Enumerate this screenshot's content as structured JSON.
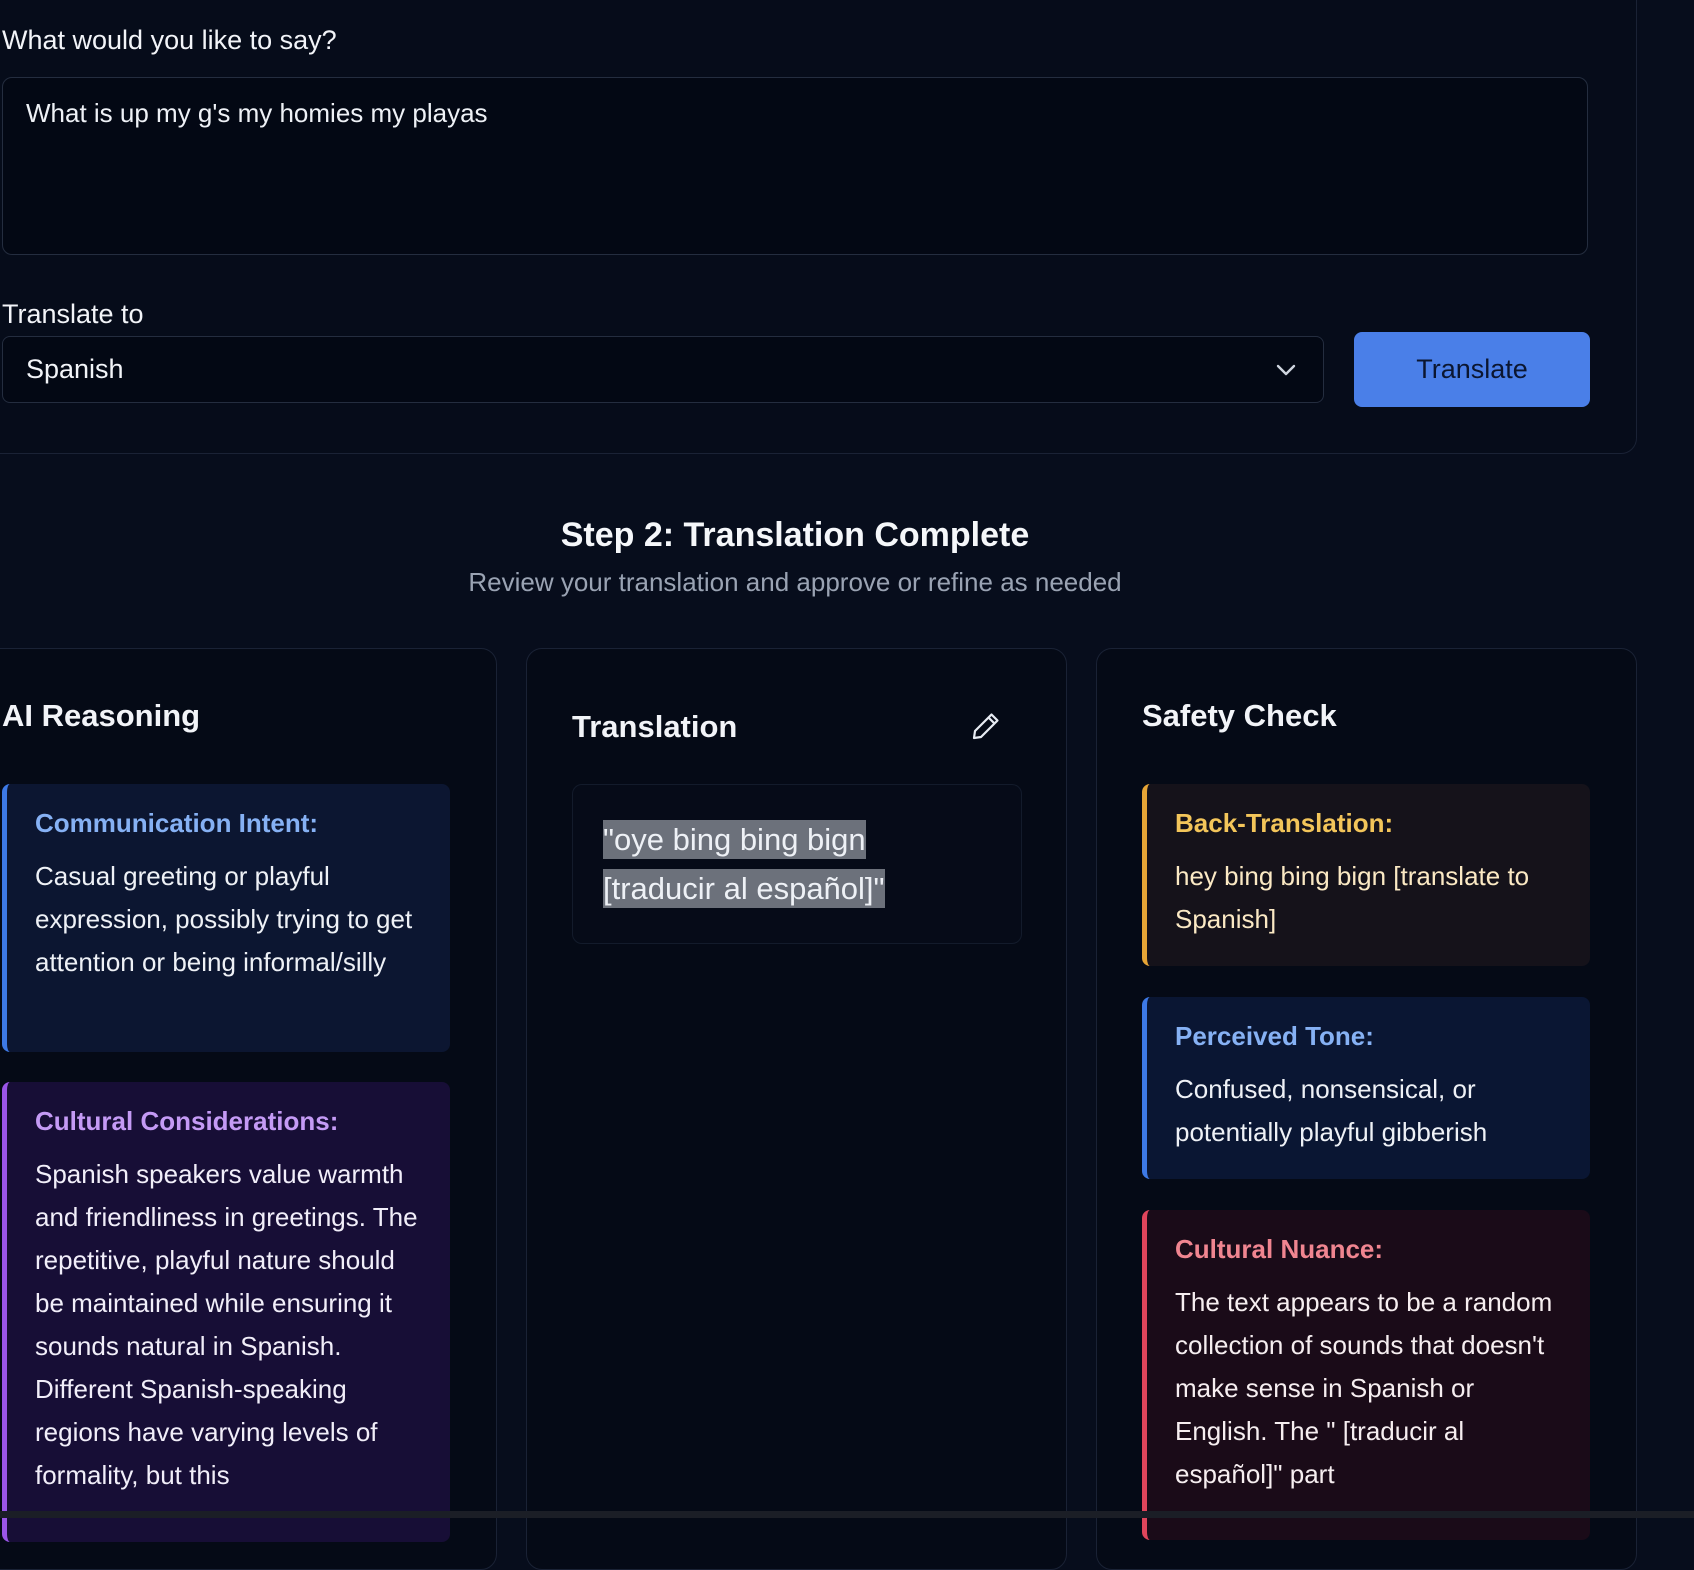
{
  "form": {
    "message_label": "What would you like to say?",
    "message_value": "What is up my g's my homies my playas",
    "language_label": "Translate to",
    "language_value": "Spanish",
    "translate_button": "Translate"
  },
  "step": {
    "title": "Step 2: Translation Complete",
    "subtitle": "Review your translation and approve or refine as needed"
  },
  "reasoning": {
    "heading": "AI Reasoning",
    "intent_title": "Communication Intent:",
    "intent_text": "Casual greeting or playful expression, possibly trying to get attention or being informal/silly",
    "cultural_title": "Cultural Considerations:",
    "cultural_text": "Spanish speakers value warmth and friendliness in greetings. The repetitive, playful nature should be maintained while ensuring it sounds natural in Spanish. Different Spanish-speaking regions have varying levels of formality, but this"
  },
  "translation": {
    "heading": "Translation",
    "text": "\"oye bing bing bign [traducir al español]\"",
    "edit_icon": "pencil-icon"
  },
  "safety": {
    "heading": "Safety Check",
    "back_title": "Back-Translation:",
    "back_text": "hey bing bing bign [translate to Spanish]",
    "tone_title": "Perceived Tone:",
    "tone_text": "Confused, nonsensical, or potentially playful gibberish",
    "nuance_title": "Cultural Nuance:",
    "nuance_text": "The text appears to be a random collection of sounds that doesn't make sense in Spanish or English. The \" [traducir al español]\" part"
  },
  "colors": {
    "accent": "#4a7fe8",
    "intent": "#3d79e6",
    "cultural": "#9a55e8",
    "back_translation": "#e7a536",
    "nuance": "#e0455b"
  }
}
